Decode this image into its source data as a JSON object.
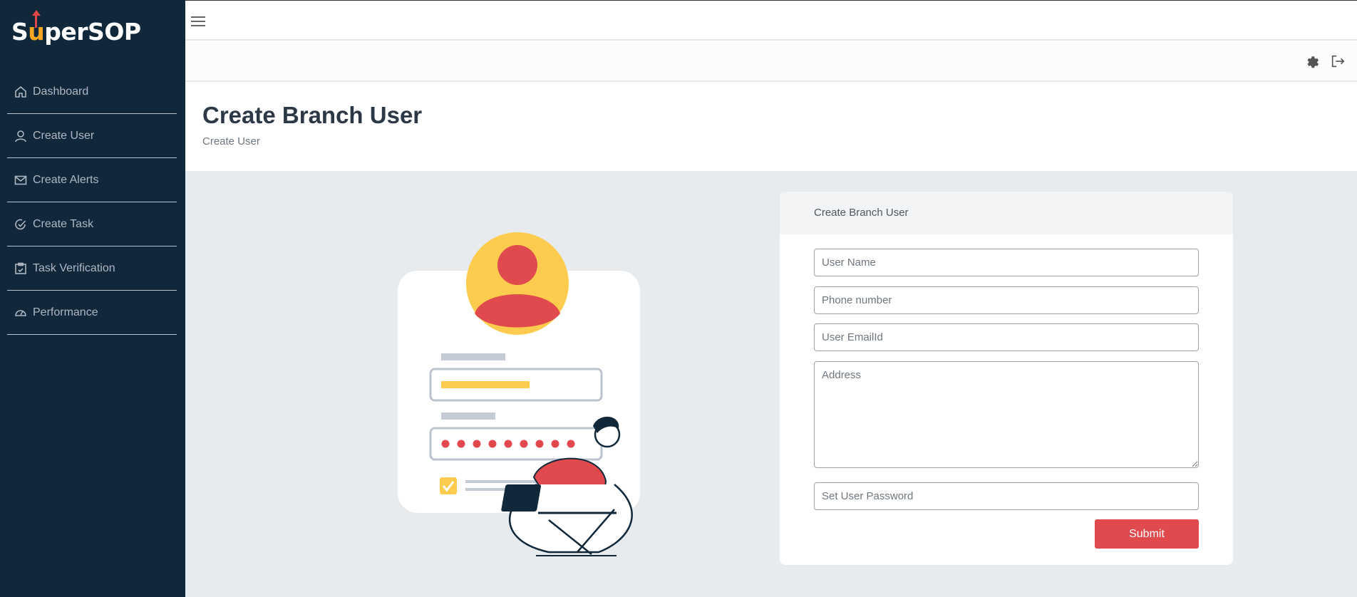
{
  "brand": {
    "name_prefix": "S",
    "name_u": "u",
    "name_suffix": "perSOP"
  },
  "sidebar": {
    "items": [
      {
        "label": "Dashboard",
        "icon": "home-icon"
      },
      {
        "label": "Create User",
        "icon": "user-icon"
      },
      {
        "label": "Create Alerts",
        "icon": "mail-icon"
      },
      {
        "label": "Create Task",
        "icon": "check-circle-icon"
      },
      {
        "label": "Task Verification",
        "icon": "clipboard-icon"
      },
      {
        "label": "Performance",
        "icon": "gauge-icon"
      }
    ]
  },
  "header": {
    "title": "Create Branch User",
    "breadcrumb": "Create User"
  },
  "form": {
    "heading": "Create Branch User",
    "username_placeholder": "User Name",
    "phone_placeholder": "Phone number",
    "email_placeholder": "User EmailId",
    "address_placeholder": "Address",
    "password_placeholder": "Set User Password",
    "submit_label": "Submit"
  },
  "colors": {
    "sidebar_bg": "#11283a",
    "accent_red": "#e04a4d",
    "accent_yellow": "#fdcb4e",
    "page_bg": "#e8ebee"
  }
}
